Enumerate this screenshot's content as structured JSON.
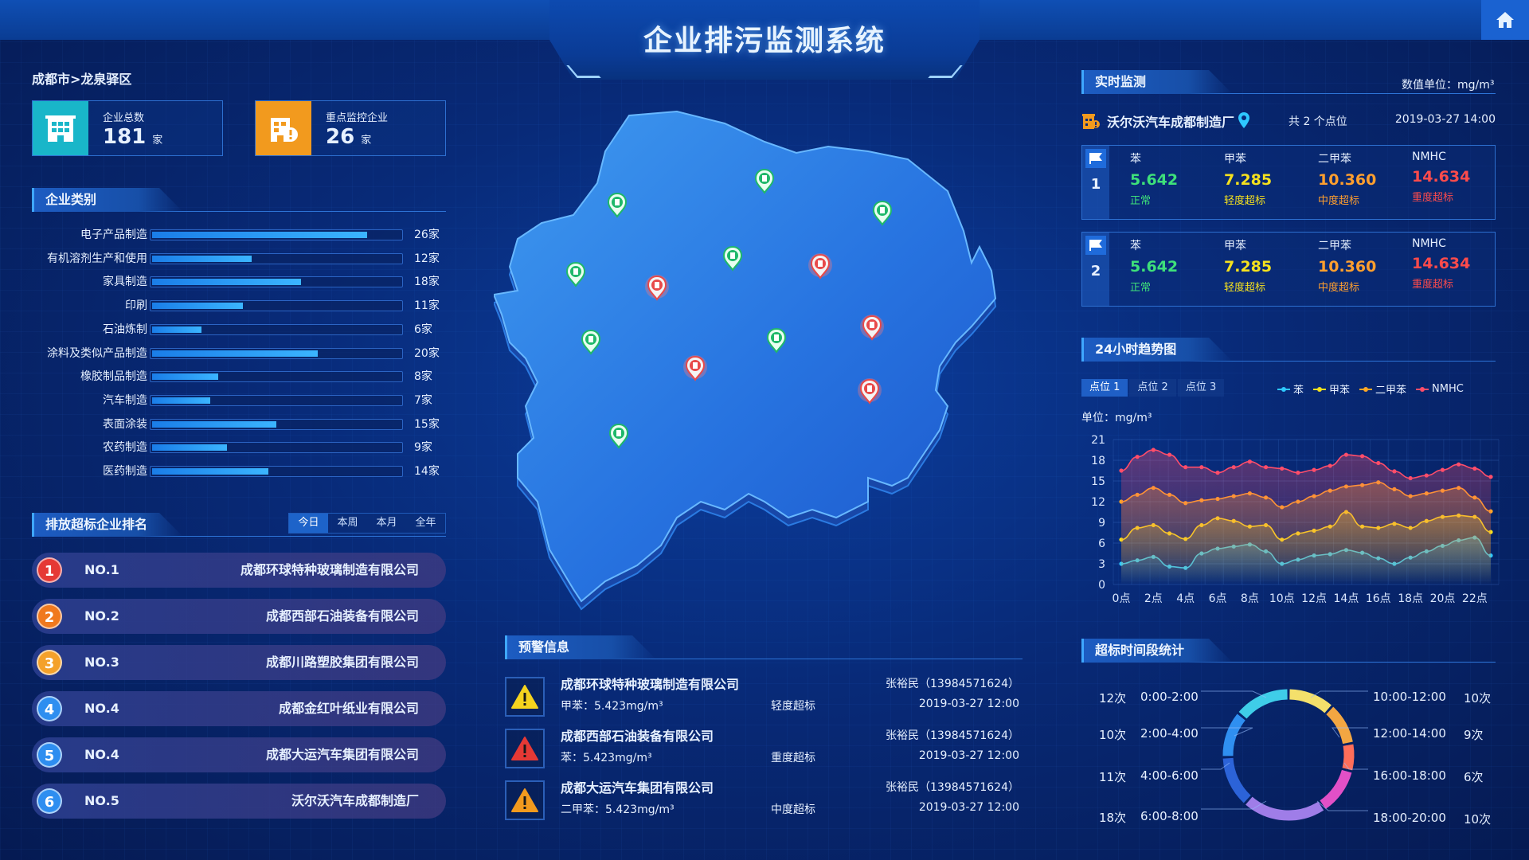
{
  "header": {
    "title": "企业排污监测系统",
    "home_icon": "home-icon"
  },
  "breadcrumb": "成都市>龙泉驿区",
  "stats": [
    {
      "label": "企业总数",
      "value": "181",
      "unit": "家",
      "color": "#19b6c9",
      "icon": "building-icon"
    },
    {
      "label": "重点监控企业",
      "value": "26",
      "unit": "家",
      "color": "#f29a1e",
      "icon": "building-alert-icon"
    }
  ],
  "category_section": {
    "title": "企业类别",
    "max": 30,
    "items": [
      {
        "label": "电子产品制造",
        "value": 26,
        "text": "26家"
      },
      {
        "label": "有机溶剂生产和使用",
        "value": 12,
        "text": "12家"
      },
      {
        "label": "家具制造",
        "value": 18,
        "text": "18家"
      },
      {
        "label": "印刷",
        "value": 11,
        "text": "11家"
      },
      {
        "label": "石油炼制",
        "value": 6,
        "text": "6家"
      },
      {
        "label": "涂料及类似产品制造",
        "value": 20,
        "text": "20家"
      },
      {
        "label": "橡胶制品制造",
        "value": 8,
        "text": "8家"
      },
      {
        "label": "汽车制造",
        "value": 7,
        "text": "7家"
      },
      {
        "label": "表面涂装",
        "value": 15,
        "text": "15家"
      },
      {
        "label": "农药制造",
        "value": 9,
        "text": "9家"
      },
      {
        "label": "医药制造",
        "value": 14,
        "text": "14家"
      }
    ]
  },
  "ranking_section": {
    "title": "排放超标企业排名",
    "tabs": [
      "今日",
      "本周",
      "本月",
      "全年"
    ],
    "active_tab": 0,
    "rows": [
      {
        "num": "1",
        "no": "NO.1",
        "name": "成都环球特种玻璃制造有限公司",
        "color": "#e53935"
      },
      {
        "num": "2",
        "no": "NO.2",
        "name": "成都西部石油装备有限公司",
        "color": "#f0791e"
      },
      {
        "num": "3",
        "no": "NO.3",
        "name": "成都川路塑胶集团有限公司",
        "color": "#f4a12a"
      },
      {
        "num": "4",
        "no": "NO.4",
        "name": "成都金红叶纸业有限公司",
        "color": "#2e8ef0"
      },
      {
        "num": "5",
        "no": "NO.4",
        "name": "成都大运汽车集团有限公司",
        "color": "#2e8ef0"
      },
      {
        "num": "6",
        "no": "NO.5",
        "name": "沃尔沃汽车成都制造厂",
        "color": "#2e8ef0"
      }
    ]
  },
  "map": {
    "markers": [
      {
        "status": "normal"
      },
      {
        "status": "normal"
      },
      {
        "status": "normal"
      },
      {
        "status": "normal"
      },
      {
        "status": "normal"
      },
      {
        "status": "normal"
      },
      {
        "status": "normal"
      },
      {
        "status": "normal"
      },
      {
        "status": "alarm"
      },
      {
        "status": "alarm"
      },
      {
        "status": "alarm"
      },
      {
        "status": "alarm"
      },
      {
        "status": "alarm"
      }
    ]
  },
  "warning_section": {
    "title": "预警信息",
    "items": [
      {
        "name": "成都环球特种玻璃制造有限公司",
        "detail": "甲苯：5.423mg/m³",
        "level": "轻度超标",
        "contact": "张裕民（13984571624）",
        "time": "2019-03-27  12:00",
        "color": "#f5d31e"
      },
      {
        "name": "成都西部石油装备有限公司",
        "detail": "苯：5.423mg/m³",
        "level": "重度超标",
        "contact": "张裕民（13984571624）",
        "time": "2019-03-27  12:00",
        "color": "#e53935"
      },
      {
        "name": "成都大运汽车集团有限公司",
        "detail": "二甲苯：5.423mg/m³",
        "level": "中度超标",
        "contact": "张裕民（13984571624）",
        "time": "2019-03-27  12:00",
        "color": "#f29a1e"
      }
    ]
  },
  "realtime_section": {
    "title": "实时监测",
    "unit": "数值单位：mg/m³",
    "plant": "沃尔沃汽车成都制造厂",
    "point_count": "共 2 个点位",
    "time": "2019-03-27  14:00",
    "points": [
      {
        "id": "1",
        "metrics": [
          {
            "name": "苯",
            "value": "5.642",
            "status": "正常",
            "color": "#3ee07a"
          },
          {
            "name": "甲苯",
            "value": "7.285",
            "status": "轻度超标",
            "color": "#f5e11e"
          },
          {
            "name": "二甲苯",
            "value": "10.360",
            "status": "中度超标",
            "color": "#ff9f2e"
          },
          {
            "name": "NMHC",
            "value": "14.634",
            "status": "重度超标",
            "color": "#ff4b4b"
          }
        ]
      },
      {
        "id": "2",
        "metrics": [
          {
            "name": "苯",
            "value": "5.642",
            "status": "正常",
            "color": "#3ee07a"
          },
          {
            "name": "甲苯",
            "value": "7.285",
            "status": "轻度超标",
            "color": "#f5e11e"
          },
          {
            "name": "二甲苯",
            "value": "10.360",
            "status": "中度超标",
            "color": "#ff9f2e"
          },
          {
            "name": "NMHC",
            "value": "14.634",
            "status": "重度超标",
            "color": "#ff4b4b"
          }
        ]
      }
    ]
  },
  "trend_section": {
    "title": "24小时趋势图",
    "tabs": [
      "点位 1",
      "点位 2",
      "点位 3"
    ],
    "active_tab": 0
  },
  "chart_data": {
    "type": "line",
    "ylabel": "单位：mg/m³",
    "ylim": [
      0,
      21
    ],
    "yticks": [
      0,
      3,
      6,
      9,
      12,
      15,
      18,
      21
    ],
    "x": [
      "0点",
      "1点",
      "2点",
      "3点",
      "4点",
      "5点",
      "6点",
      "7点",
      "8点",
      "9点",
      "10点",
      "11点",
      "12点",
      "13点",
      "14点",
      "15点",
      "16点",
      "17点",
      "18点",
      "19点",
      "20点",
      "21点",
      "22点",
      "23点"
    ],
    "xtick_labels": [
      "0点",
      "2点",
      "4点",
      "6点",
      "8点",
      "10点",
      "12点",
      "14点",
      "16点",
      "18点",
      "20点",
      "22点"
    ],
    "series": [
      {
        "name": "苯",
        "color": "#2ec8ff",
        "values": [
          3.0,
          3.5,
          4.0,
          2.6,
          2.4,
          4.5,
          5.2,
          5.5,
          5.8,
          4.8,
          3.0,
          3.6,
          4.2,
          4.4,
          5.0,
          4.6,
          3.8,
          3.0,
          3.9,
          4.8,
          5.6,
          6.4,
          6.8,
          4.2
        ]
      },
      {
        "name": "甲苯",
        "color": "#f5e11e",
        "values": [
          6.5,
          8.2,
          8.6,
          7.4,
          6.6,
          8.6,
          9.6,
          9.2,
          8.4,
          8.6,
          6.5,
          7.4,
          7.8,
          8.4,
          10.5,
          8.4,
          8.2,
          8.8,
          8.2,
          9.2,
          9.8,
          10.0,
          9.8,
          7.6
        ]
      },
      {
        "name": "二甲苯",
        "color": "#ffa726",
        "values": [
          12.0,
          13.0,
          14.0,
          13.0,
          11.8,
          12.2,
          12.4,
          12.8,
          13.2,
          12.6,
          11.2,
          12.0,
          12.8,
          13.6,
          14.2,
          14.4,
          14.8,
          13.8,
          12.8,
          13.2,
          13.6,
          14.0,
          12.6,
          10.6
        ]
      },
      {
        "name": "NMHC",
        "color": "#ff4d6a",
        "values": [
          16.5,
          18.5,
          19.5,
          18.8,
          17.0,
          17.0,
          16.2,
          17.0,
          17.8,
          17.0,
          16.8,
          16.2,
          16.6,
          17.2,
          18.8,
          18.6,
          17.6,
          16.4,
          15.4,
          15.8,
          16.6,
          17.4,
          16.8,
          15.6
        ]
      }
    ]
  },
  "overlimit_section": {
    "title": "超标时间段统计",
    "slices": [
      {
        "range": "0:00-2:00",
        "count": "12次",
        "value": 12,
        "color": "#3fcde8"
      },
      {
        "range": "2:00-4:00",
        "count": "10次",
        "value": 10,
        "color": "#2f8ff0"
      },
      {
        "range": "4:00-6:00",
        "count": "11次",
        "value": 11,
        "color": "#2c63d8"
      },
      {
        "range": "6:00-8:00",
        "count": "18次",
        "value": 18,
        "color": "#9f7de8"
      },
      {
        "range": "18:00-20:00",
        "count": "10次",
        "value": 10,
        "color": "#e150c7"
      },
      {
        "range": "16:00-18:00",
        "count": "6次",
        "value": 6,
        "color": "#ff6e5a"
      },
      {
        "range": "12:00-14:00",
        "count": "9次",
        "value": 9,
        "color": "#f2a642"
      },
      {
        "range": "10:00-12:00",
        "count": "10次",
        "value": 10,
        "color": "#f4e06b"
      }
    ]
  }
}
